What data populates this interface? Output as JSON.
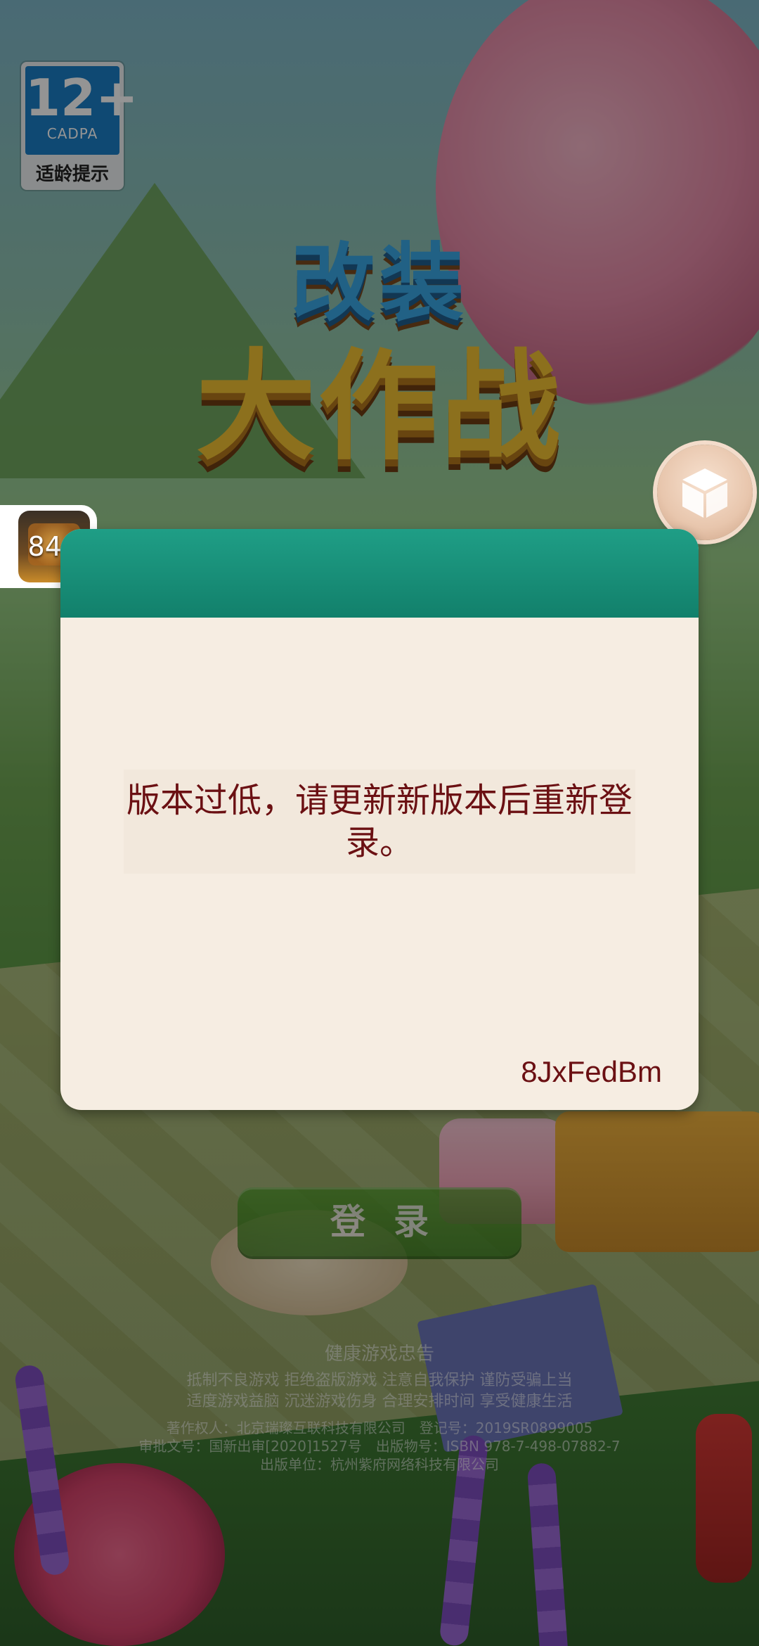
{
  "age_badge": {
    "rating": "12+",
    "org": "CADPA",
    "hint": "适龄提示"
  },
  "logo": {
    "line1": "改装",
    "line2": "大作战"
  },
  "mini_float": {
    "percent": "84",
    "percent_sign": "%"
  },
  "dialog": {
    "message": "版本过低，请更新新版本后重新登录。",
    "code": "8JxFedBm"
  },
  "login_button": {
    "label": "登录"
  },
  "notice": {
    "title": "健康游戏忠告",
    "line1": "抵制不良游戏 拒绝盗版游戏 注意自我保护 谨防受骗上当",
    "line2": "适度游戏益脑 沉迷游戏伤身 合理安排时间 享受健康生活",
    "copyright": "著作权人：北京瑞璨互联科技有限公司　登记号：2019SR0899005",
    "approval": "审批文号：国新出审[2020]1527号　出版物号：ISBN 978-7-498-07882-7",
    "publisher": "出版单位：杭州紫府网络科技有限公司"
  },
  "icons": {
    "cube": "cube-icon"
  },
  "colors": {
    "dialog_header": "#12806b",
    "dialog_bg": "#f6ede2",
    "message_text": "#6b1013",
    "login_button": "#2f7a16"
  }
}
